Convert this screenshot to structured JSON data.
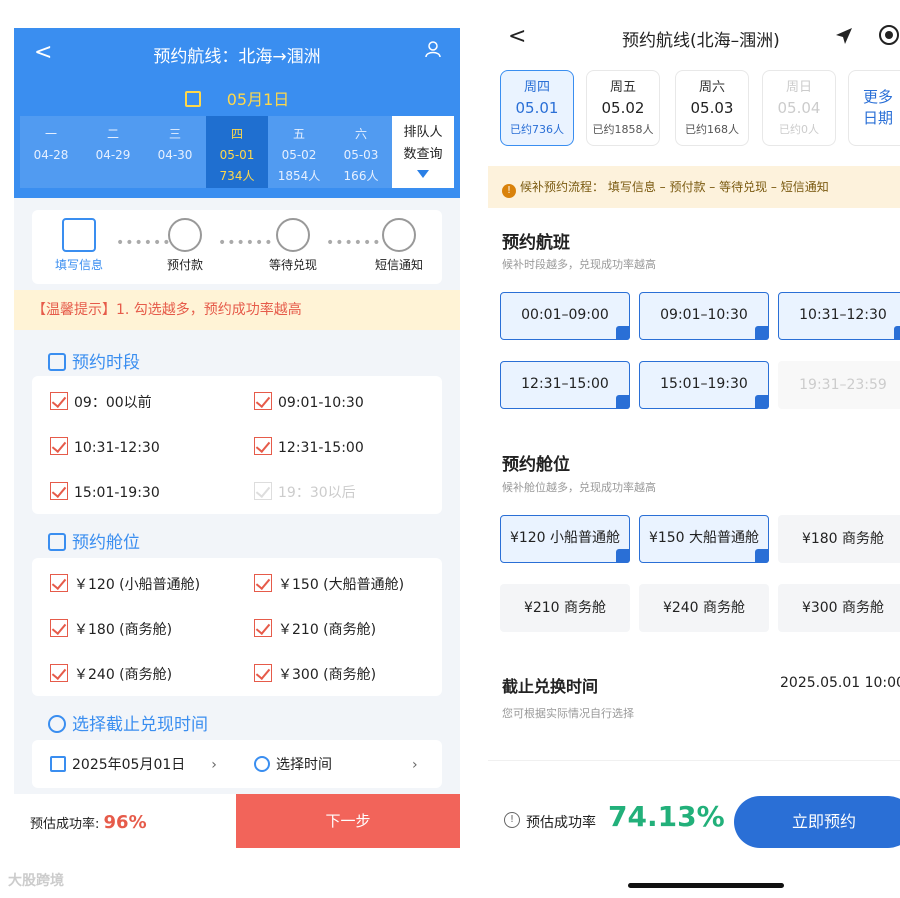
{
  "left": {
    "header": {
      "back": "<",
      "title": "预约航线：北海→涠洲",
      "user_icon": "user-icon"
    },
    "date_label": "05月1日",
    "days": [
      {
        "wd": "一",
        "date": "04-28",
        "count": ""
      },
      {
        "wd": "二",
        "date": "04-29",
        "count": ""
      },
      {
        "wd": "三",
        "date": "04-30",
        "count": ""
      },
      {
        "wd": "四",
        "date": "05-01",
        "count": "734人"
      },
      {
        "wd": "五",
        "date": "05-02",
        "count": "1854人"
      },
      {
        "wd": "六",
        "date": "05-03",
        "count": "166人"
      }
    ],
    "queue": {
      "line1": "排队人",
      "line2": "数查询"
    },
    "steps": [
      "填写信息",
      "预付款",
      "等待兑现",
      "短信通知"
    ],
    "tip": "【温馨提示】1. 勾选越多，预约成功率越高",
    "time_title": "预约时段",
    "times": [
      "09：00以前",
      "09:01-10:30",
      "10:31-12:30",
      "12:31-15:00",
      "15:01-19:30",
      "19：30以后"
    ],
    "cabin_title": "预约舱位",
    "cabins": [
      "￥120 (小船普通舱)",
      "￥150 (大船普通舱)",
      "￥180 (商务舱)",
      "￥210 (商务舱)",
      "￥240 (商务舱)",
      "￥300 (商务舱)"
    ],
    "deadline_title": "选择截止兑现时间",
    "deadline_date": "2025年05月01日",
    "deadline_time": "选择时间",
    "rate_label": "预估成功率:",
    "rate_value": "96%",
    "next": "下一步"
  },
  "watermark": "大股跨境",
  "right": {
    "back": "<",
    "title": "预约航线(北海–涠洲)",
    "days": [
      {
        "wd": "周四",
        "date": "05.01",
        "count": "已约736人"
      },
      {
        "wd": "周五",
        "date": "05.02",
        "count": "已约1858人"
      },
      {
        "wd": "周六",
        "date": "05.03",
        "count": "已约168人"
      },
      {
        "wd": "周日",
        "date": "05.04",
        "count": "已约0人"
      }
    ],
    "more": {
      "line1": "更多",
      "line2": "日期"
    },
    "note": "候补预约流程：  填写信息 – 预付款 – 等待兑现 – 短信通知",
    "flight_title": "预约航班",
    "flight_sub": "候补时段越多，兑现成功率越高",
    "times": [
      "00:01–09:00",
      "09:01–10:30",
      "10:31–12:30",
      "12:31–15:00",
      "15:01–19:30",
      "19:31–23:59"
    ],
    "cabin_title": "预约舱位",
    "cabin_sub": "候补舱位越多，兑现成功率越高",
    "cabins": [
      "¥120 小船普通舱",
      "¥150 大船普通舱",
      "¥180 商务舱",
      "¥210 商务舱",
      "¥240 商务舱",
      "¥300 商务舱"
    ],
    "deadline_title": "截止兑换时间",
    "deadline_value": "2025.05.01 10:00",
    "deadline_sub": "您可根据实际情况自行选择",
    "rate_label": "预估成功率",
    "rate_value": "74.13%",
    "reserve": "立即预约"
  }
}
